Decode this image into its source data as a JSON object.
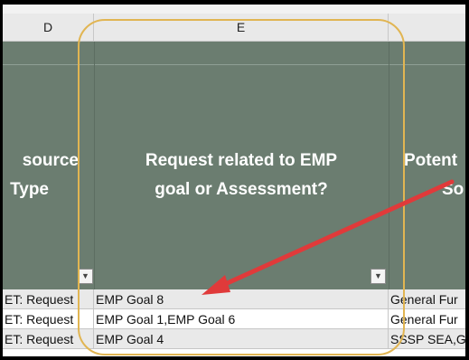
{
  "columns": [
    {
      "letter": "D"
    },
    {
      "letter": "E"
    }
  ],
  "header": {
    "col_d_lines": [
      "source",
      "Type"
    ],
    "col_e_lines": [
      "Request related to EMP",
      "goal or Assessment?"
    ],
    "col_f_lines": [
      "Potent",
      "So"
    ]
  },
  "filter_icon": "dropdown-arrow",
  "rows": [
    {
      "d": "ET: Request",
      "e": "EMP Goal 8",
      "f": "General Fur"
    },
    {
      "d": "ET: Request",
      "e": "EMP Goal 1,EMP Goal 6",
      "f": "General Fur"
    },
    {
      "d": "ET: Request",
      "e": "EMP Goal 4",
      "f": "SSSP SEA,Ge"
    }
  ],
  "colors": {
    "header_fill": "#6b7d70",
    "highlight": "#e1b552",
    "arrow": "#e03a3a",
    "row_alt": "#e9e9e9"
  }
}
